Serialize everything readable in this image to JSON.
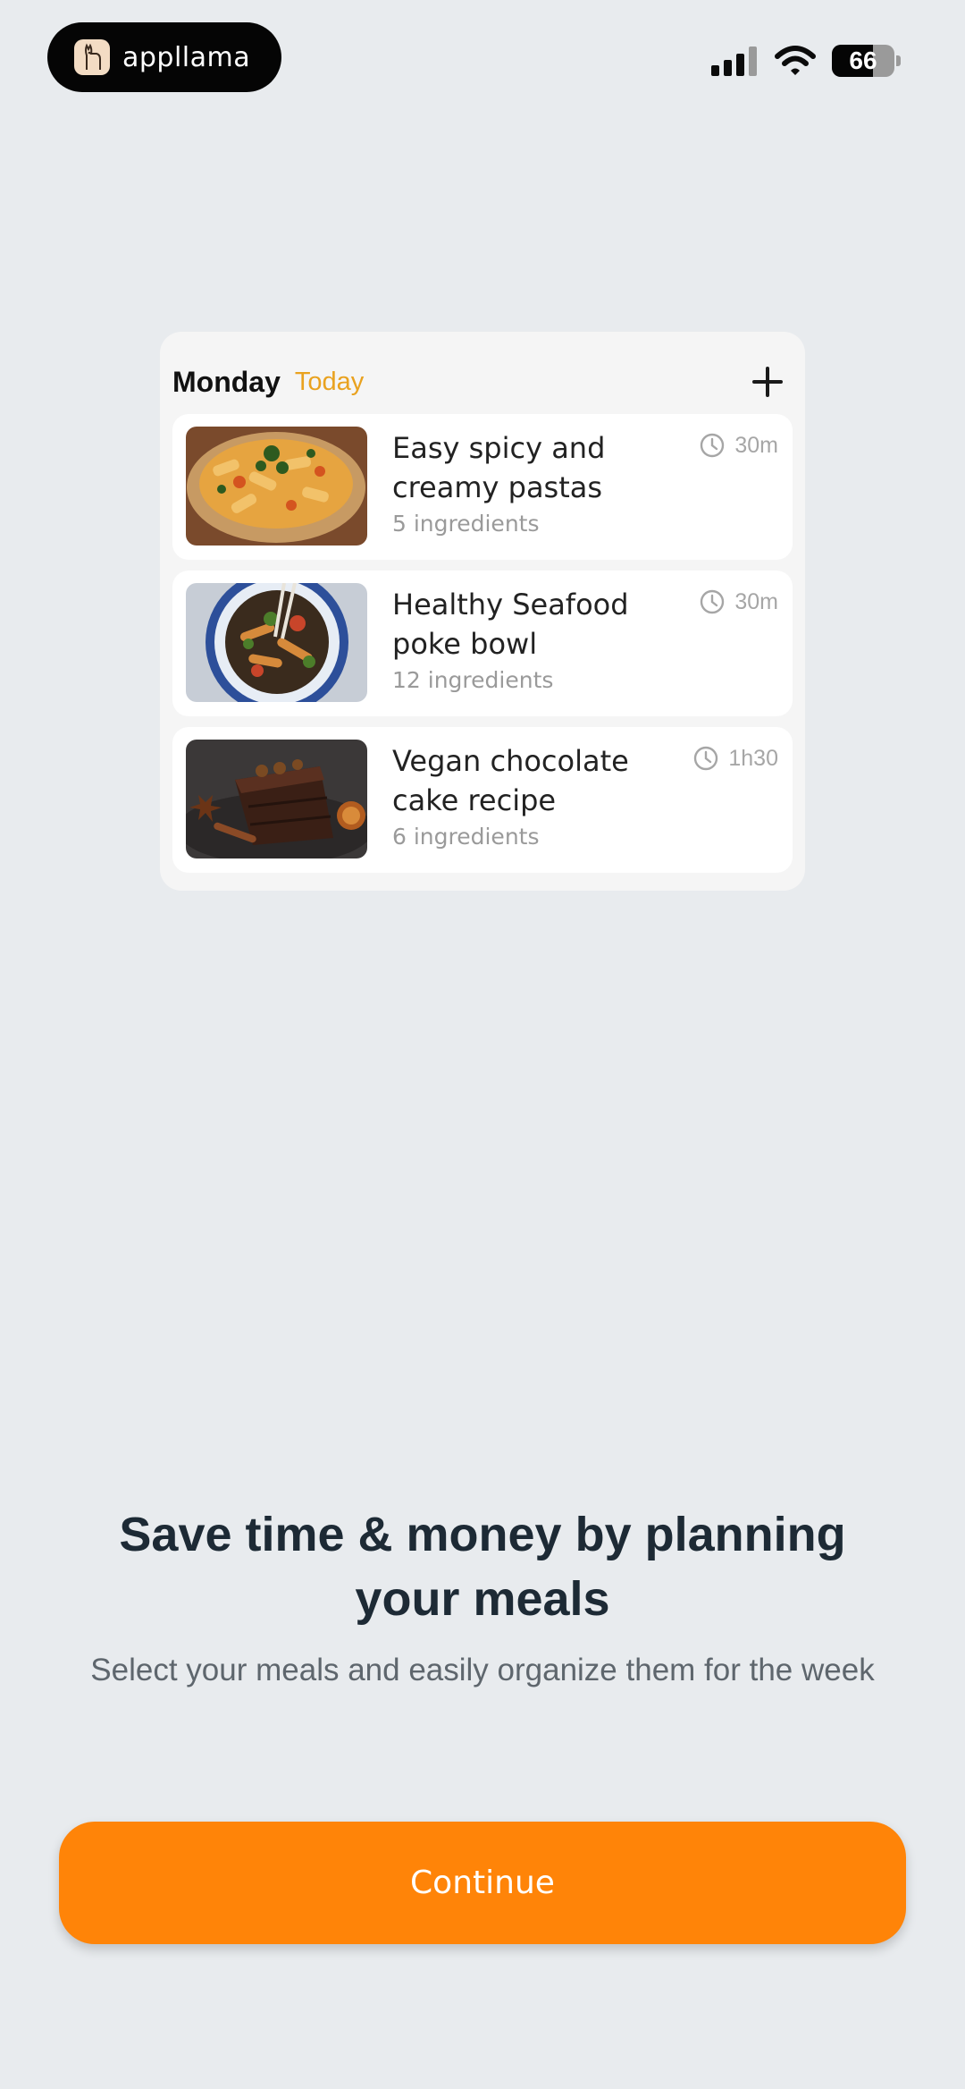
{
  "status_bar": {
    "brand_name": "appllama",
    "battery_level": "66",
    "battery_fraction": 0.66
  },
  "plan": {
    "day": "Monday",
    "today_label": "Today",
    "meals": [
      {
        "title": "Easy spicy and creamy pastas",
        "ingredients": "5 ingredients",
        "time": "30m",
        "image": "pasta-dish"
      },
      {
        "title": "Healthy Seafood poke bowl",
        "ingredients": "12 ingredients",
        "time": "30m",
        "image": "poke-bowl"
      },
      {
        "title": "Vegan chocolate cake recipe",
        "ingredients": "6 ingredients",
        "time": "1h30",
        "image": "chocolate-cake"
      }
    ]
  },
  "onboarding": {
    "headline": "Save time & money by planning your meals",
    "subline": "Select your meals and easily organize them for the week",
    "continue_label": "Continue"
  },
  "colors": {
    "accent": "#ff8408",
    "today": "#e9a21f",
    "background": "#e8ebee"
  },
  "icons": [
    "llama-logo-icon",
    "signal-icon",
    "wifi-icon",
    "battery-icon",
    "plus-icon",
    "clock-icon"
  ]
}
